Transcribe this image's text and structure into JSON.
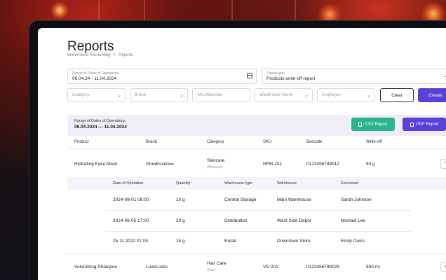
{
  "page": {
    "title": "Reports",
    "breadcrumb": [
      "Warehouse Accounting",
      ">",
      "Reports"
    ]
  },
  "filters": {
    "date_range_label": "Range of Dates of Operations",
    "date_range_value": "06.04.24 - 11.04.2024",
    "report_type_label": "Report type",
    "report_type_value": "Products write-off report",
    "category_placeholder": "Category",
    "brand_placeholder": "Brand",
    "sku_placeholder": "SKU/Barcode",
    "warehouse_placeholder": "Warehouse Name",
    "employee_placeholder": "Employee",
    "clear_label": "Clear",
    "create_label": "Create"
  },
  "summary": {
    "label": "Range of Dates of Operations",
    "value": "06.04.2024 — 11.04.2024",
    "csv_label": "CSV Report",
    "pdf_label": "PDF Report"
  },
  "table": {
    "columns": [
      "Product",
      "Brand",
      "Category",
      "SKU",
      "Barcode",
      "Write-off"
    ],
    "rows": [
      {
        "product": "Hydrating Face Mask",
        "brand": "GlowEssence",
        "category": "Skincare",
        "category_sub": "(Skincare)",
        "sku": "HFM-101",
        "barcode": "0123456789012",
        "writeoff": "50 g",
        "toggle": "^"
      },
      {
        "product": "Volumizing Shampoo",
        "brand": "LuxeLocks",
        "category": "Hair Care",
        "category_sub": "(Hair)",
        "sku": "VS-202",
        "barcode": "0123456789029",
        "writeoff": "500 ml",
        "toggle": "v"
      }
    ]
  },
  "subtable": {
    "columns": [
      "Date of Operation",
      "Quantity",
      "Warehouse type",
      "Warehouse",
      "Executant"
    ],
    "rows": [
      [
        "2024-08-01 09:00",
        "10 g",
        "Central Storage",
        "Main Warehouse",
        "Sarah Johnson"
      ],
      [
        "2024-08-05 17:00",
        "20 g",
        "Distribution",
        "West Side Depot",
        "Michael Lee"
      ],
      [
        "25.11.2022 07:00",
        "15 g",
        "Retail",
        "Downtown Store",
        "Emily Davis"
      ]
    ]
  },
  "colors": {
    "accent": "#5b3fd6",
    "csv": "#2bb58a"
  }
}
